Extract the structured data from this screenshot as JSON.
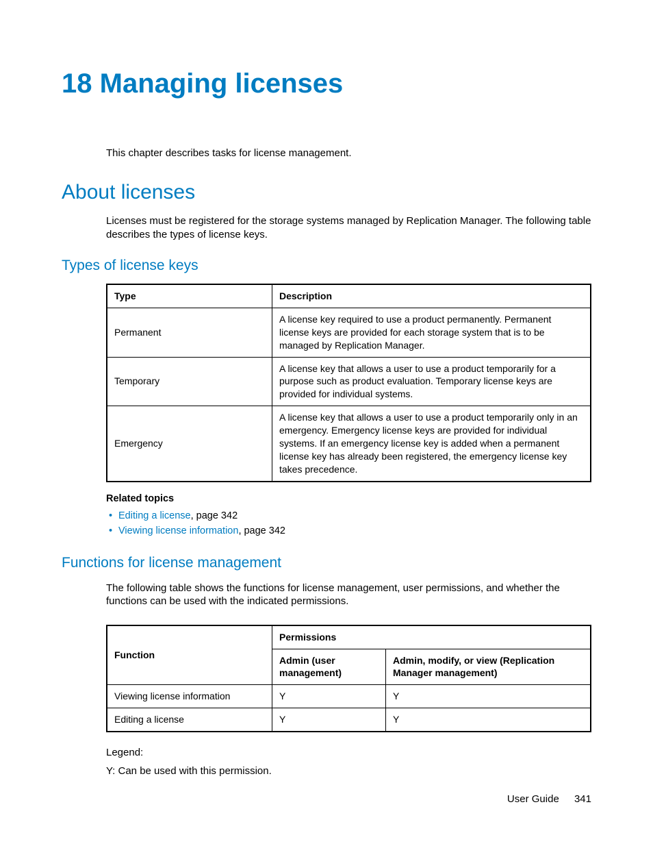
{
  "chapter": {
    "number": "18",
    "title": "Managing licenses",
    "intro": "This chapter describes tasks for license management."
  },
  "about": {
    "heading": "About licenses",
    "body": "Licenses must be registered for the storage systems managed by Replication Manager. The following table describes the types of license keys."
  },
  "types": {
    "heading": "Types of license keys",
    "columns": {
      "type": "Type",
      "description": "Description"
    },
    "rows": [
      {
        "type": "Permanent",
        "description": "A license key required to use a product permanently. Permanent license keys are provided for each storage system that is to be managed by Replication Manager."
      },
      {
        "type": "Temporary",
        "description": "A license key that allows a user to use a product temporarily for a purpose such as product evaluation. Temporary license keys are provided for individual systems."
      },
      {
        "type": "Emergency",
        "description": "A license key that allows a user to use a product temporarily only in an emergency. Emergency license keys are provided for individual systems. If an emergency license key is added when a permanent license key has already been registered, the emergency license key takes precedence."
      }
    ]
  },
  "related": {
    "heading": "Related topics",
    "items": [
      {
        "link": "Editing a license",
        "suffix": ", page 342"
      },
      {
        "link": "Viewing license information",
        "suffix": ", page 342"
      }
    ]
  },
  "functions": {
    "heading": "Functions for license management",
    "body": "The following table shows the functions for license management, user permissions, and whether the functions can be used with the indicated permissions.",
    "columns": {
      "function": "Function",
      "permissions": "Permissions",
      "admin_user": "Admin (user management)",
      "admin_modify": "Admin, modify, or view (Replication Manager management)"
    },
    "rows": [
      {
        "function": "Viewing license information",
        "admin_user": "Y",
        "admin_modify": "Y"
      },
      {
        "function": "Editing a license",
        "admin_user": "Y",
        "admin_modify": "Y"
      }
    ],
    "legend_label": "Legend:",
    "legend_text": "Y: Can be used with this permission."
  },
  "footer": {
    "doc": "User Guide",
    "page": "341"
  }
}
